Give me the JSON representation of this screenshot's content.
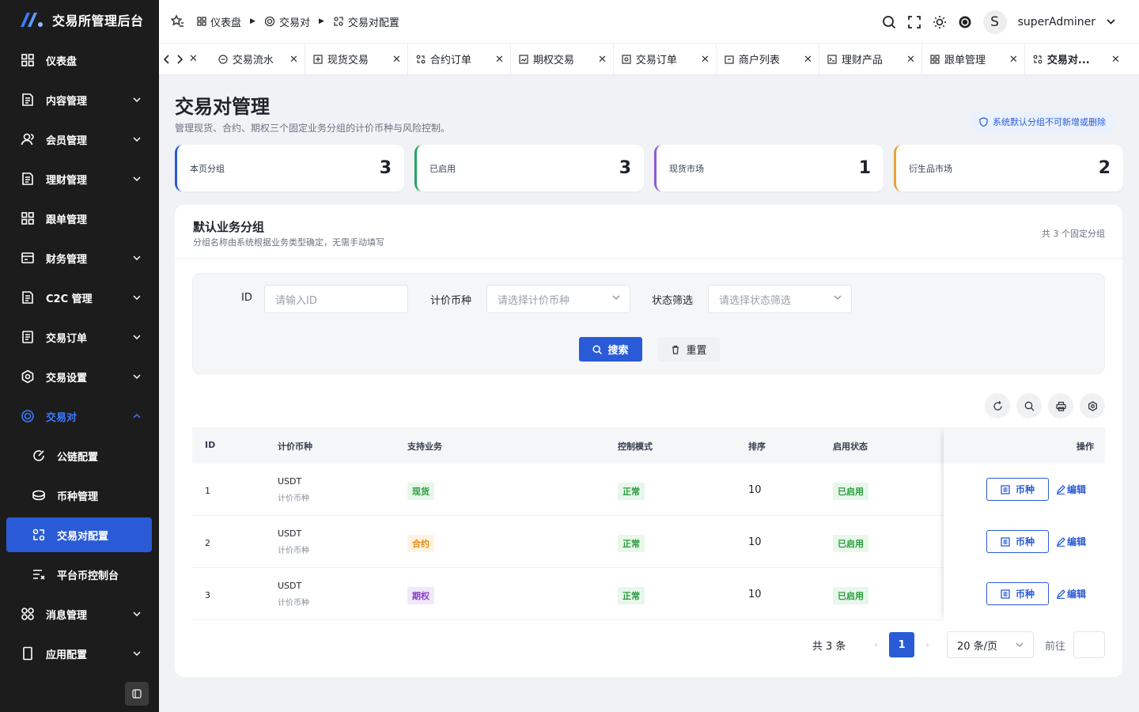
{
  "app": {
    "title": "交易所管理后台"
  },
  "sidebar": {
    "items": [
      {
        "label": "仪表盘",
        "icon": "dashboard-icon"
      },
      {
        "label": "内容管理",
        "icon": "document-icon"
      },
      {
        "label": "会员管理",
        "icon": "user-icon"
      },
      {
        "label": "理财管理",
        "icon": "document-icon"
      },
      {
        "label": "跟单管理",
        "icon": "grid-icon"
      },
      {
        "label": "财务管理",
        "icon": "wallet-icon"
      },
      {
        "label": "C2C 管理",
        "icon": "document-icon"
      },
      {
        "label": "交易订单",
        "icon": "order-icon"
      },
      {
        "label": "交易设置",
        "icon": "gear-icon"
      },
      {
        "label": "交易对",
        "icon": "exchange-icon"
      },
      {
        "label": "公链配置",
        "icon": "link-icon"
      },
      {
        "label": "币种管理",
        "icon": "coin-icon"
      },
      {
        "label": "交易对配置",
        "icon": "pair-config-icon"
      },
      {
        "label": "平台币控制台",
        "icon": "control-icon"
      },
      {
        "label": "消息管理",
        "icon": "message-icon"
      },
      {
        "label": "应用配置",
        "icon": "app-icon"
      }
    ]
  },
  "header": {
    "breadcrumb": [
      "仪表盘",
      "交易对",
      "交易对配置"
    ],
    "username": "superAdminer",
    "avatar_letter": "S"
  },
  "tabs": [
    {
      "label": "交易流水"
    },
    {
      "label": "现货交易"
    },
    {
      "label": "合约订单"
    },
    {
      "label": "期权交易"
    },
    {
      "label": "交易订单"
    },
    {
      "label": "商户列表"
    },
    {
      "label": "理财产品"
    },
    {
      "label": "跟单管理"
    },
    {
      "label": "交易对..."
    }
  ],
  "page": {
    "title": "交易对管理",
    "subtitle": "管理现货、合约、期权三个固定业务分组的计价币种与风险控制。",
    "notice": "系统默认分组不可新增或删除"
  },
  "stats": [
    {
      "label": "本页分组",
      "value": "3",
      "color": "#2a5bd7"
    },
    {
      "label": "已启用",
      "value": "3",
      "color": "#22a660"
    },
    {
      "label": "现货市场",
      "value": "1",
      "color": "#8a5cd7"
    },
    {
      "label": "衍生品市场",
      "value": "2",
      "color": "#e5a43a"
    }
  ],
  "card": {
    "title": "默认业务分组",
    "subtitle": "分组名称由系统根据业务类型确定，无需手动填写",
    "count": "共 3 个固定分组"
  },
  "filter": {
    "id_label": "ID",
    "id_placeholder": "请输入ID",
    "coin_label": "计价币种",
    "coin_placeholder": "请选择计价币种",
    "status_label": "状态筛选",
    "status_placeholder": "请选择状态筛选",
    "search_btn": "搜索",
    "reset_btn": "重置"
  },
  "table": {
    "headers": [
      "ID",
      "计价币种",
      "支持业务",
      "控制模式",
      "排序",
      "启用状态",
      "操作"
    ],
    "rows": [
      {
        "id": "1",
        "coin": "USDT",
        "coin_sub": "计价币种",
        "business": "现货",
        "mode": "正常",
        "sort": "10",
        "status": "已启用"
      },
      {
        "id": "2",
        "coin": "USDT",
        "coin_sub": "计价币种",
        "business": "合约",
        "mode": "正常",
        "sort": "10",
        "status": "已启用"
      },
      {
        "id": "3",
        "coin": "USDT",
        "coin_sub": "计价币种",
        "business": "期权",
        "mode": "正常",
        "sort": "10",
        "status": "已启用"
      }
    ],
    "op_coin": "币种",
    "op_edit": "编辑"
  },
  "pager": {
    "total": "共 3 条",
    "current": "1",
    "size": "20 条/页",
    "goto": "前往"
  }
}
